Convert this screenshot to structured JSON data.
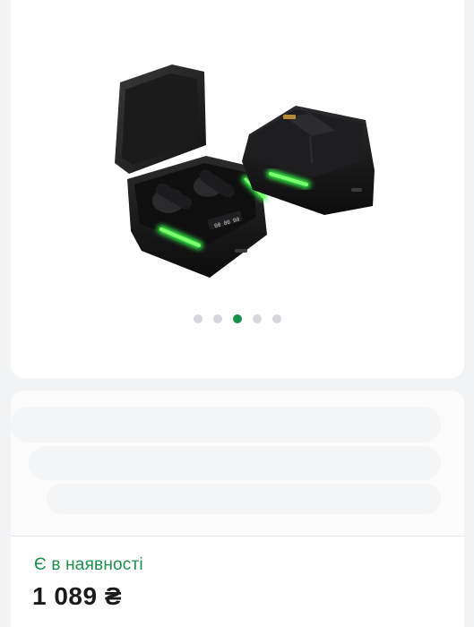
{
  "gallery": {
    "image_alt": "wireless-earbuds-charging-case",
    "slide_count": 5,
    "active_index": 2,
    "accent_color": "#18904a",
    "dots": [
      "",
      "",
      "",
      "",
      ""
    ]
  },
  "product": {
    "availability": "Є в наявності",
    "price": "1 089 ₴"
  }
}
